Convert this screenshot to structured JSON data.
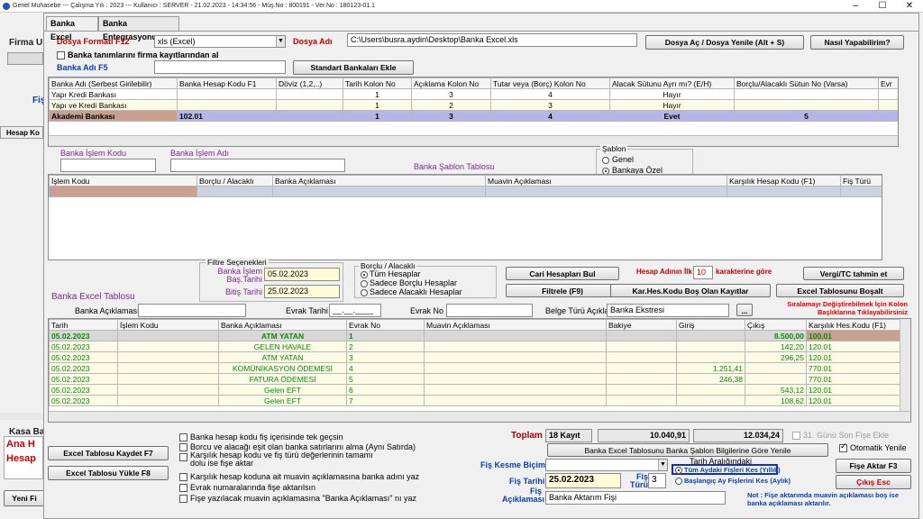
{
  "titlebar": {
    "text": "Genel Muhasebe  ---  Çalışma Yılı : 2023  ---  Kullanıcı : SERVER - 21.02.2023 - 14:34:56 - Müş.No : 800191 - Ver.No : 180123-01.1"
  },
  "background": {
    "firma": "Firma U",
    "fis": "Fiş",
    "hesap_kodu": "Hesap Ko",
    "kasa": "Kasa Ba",
    "ana": "Ana H",
    "hesap": "Hesap",
    "yeni": "Yeni Fi"
  },
  "tabs": [
    "Banka Excel",
    "Banka Entegrasyonu"
  ],
  "top": {
    "format_label": "Dosya Formatı F12",
    "format_value": "xls (Excel)",
    "file_label": "Dosya Adı",
    "file_value": "C:\\Users\\busra.aydin\\Desktop\\Banka Excel.xls",
    "open_btn": "Dosya Aç / Dosya Yenile (Alt + S)",
    "how_btn": "Nasıl Yapabilirim?",
    "bank_check_label": "Banka tanımlarını firma kayıtlarından al",
    "bank_name_label": "Banka Adı F5",
    "std_btn": "Standart Bankaları Ekle"
  },
  "bank_table": {
    "columns": [
      "Banka Adı (Serbest Girilebilir)",
      "Banka Hesap Kodu F1",
      "Döviz (1,2,..)",
      "Tarih Kolon No",
      "Açıklama Kolon No",
      "Tutar veya (Borç) Kolon No",
      "Alacak Sütunu Ayrı mı? (E/H)",
      "Borçlu/Alacaklı Sütun No (Varsa)",
      "Evr"
    ],
    "rows": [
      [
        "Yapı Kredi Bankası",
        "",
        "",
        "1",
        "3",
        "4",
        "Hayır",
        "",
        ""
      ],
      [
        "Yapı ve Kredi Bankası",
        "",
        "",
        "1",
        "2",
        "3",
        "Hayır",
        "",
        ""
      ],
      [
        "Akademi Bankası",
        "102.01",
        "",
        "1",
        "3",
        "4",
        "Evet",
        "5",
        ""
      ]
    ]
  },
  "sablon": {
    "islem_kodu_label": "Banka İşlem Kodu",
    "islem_adi_label": "Banka İşlem Adı",
    "table_title": "Banka Şablon Tablosu",
    "group_title": "Şablon",
    "opt_genel": "Genel",
    "opt_ozel": "Bankaya Özel",
    "columns": [
      "İşlem Kodu",
      "Borçlu / Alacaklı",
      "Banka Açıklaması",
      "Muavin Açıklaması",
      "Karşılık Hesap Kodu (F1)",
      "Fiş Türü"
    ]
  },
  "filter": {
    "group_title": "Filtre Seçenekleri",
    "start_label": "Banka İşlem Baş.Tarihi",
    "start_value": "05.02.2023",
    "end_label": "Bitiş Tarihi",
    "end_value": "25.02.2023",
    "ba_group": "Borçlu / Alacaklı",
    "ba_all": "Tüm Hesaplar",
    "ba_borc": "Sadece Borçlu Hesaplar",
    "ba_alacak": "Sadece Alacaklı Hesaplar",
    "cari_btn": "Cari Hesapları Bul",
    "filtrele_btn": "Filtrele (F9)",
    "hesap_adi_prefix": "Hesap Adının  İlk",
    "hesap_adi_value": "10",
    "hesap_adi_suffix": "karakterine göre",
    "vergi_btn": "Vergi/TC tahmin et",
    "karhes_btn": "Kar.Hes.Kodu Boş Olan Kayıtlar",
    "bosalt_btn": "Excel Tablosunu Boşalt",
    "sort_note": "Sıralamayı Değiştirebilmek İçin Kolon Başlıklarına Tıklayabilirsiniz"
  },
  "excel": {
    "title": "Banka Excel Tablosu",
    "aciklama_label": "Banka Açıklaması",
    "evrak_tarihi_label": "Evrak Tarihi",
    "evrak_tarihi_value": "__.__.____",
    "evrak_no_label": "Evrak No",
    "belge_label": "Belge Türü Açıklaması",
    "belge_value": "Banka Ekstresi",
    "dots": "...",
    "columns": [
      "Tarih",
      "İşlem Kodu",
      "Banka Açıklaması",
      "Evrak No",
      "Muavin Açıklaması",
      "Bakiye",
      "Giriş",
      "Çıkış",
      "Karşılık Hes.Kodu (F1)"
    ],
    "rows": [
      [
        "05.02.2023",
        "",
        "ATM YATAN",
        "1",
        "",
        "",
        "",
        "8.500,00",
        "100.01"
      ],
      [
        "05.02.2023",
        "",
        "GELEN HAVALE",
        "2",
        "",
        "",
        "",
        "142,20",
        "120.01"
      ],
      [
        "05.02.2023",
        "",
        "ATM YATAN",
        "3",
        "",
        "",
        "",
        "296,25",
        "120.01"
      ],
      [
        "05.02.2023",
        "",
        "KOMÜNİKASYON ÖDEMESİ",
        "4",
        "",
        "",
        "1.251,41",
        "",
        "770.01"
      ],
      [
        "05.02.2023",
        "",
        "FATURA ÖDEMESİ",
        "5",
        "",
        "",
        "246,38",
        "",
        "770.01"
      ],
      [
        "05.02.2023",
        "",
        "Gelen EFT",
        "6",
        "",
        "",
        "",
        "543,12",
        "120.01"
      ],
      [
        "05.02.2023",
        "",
        "Gelen EFT",
        "7",
        "",
        "",
        "",
        "108,62",
        "120.01"
      ]
    ]
  },
  "bottom": {
    "save_btn": "Excel Tablosu Kaydet F7",
    "load_btn": "Excel Tablosu Yükle F8",
    "options": [
      "Banka hesap kodu fiş içerisinde tek geçsin",
      "Borcu ve alacağı eşit olan banka satırlarını alma (Aynı Satırda)",
      "Karşılık hesap kodu ve fiş türü değerlerinin tamamı dolu ise fişe aktar",
      "Karşılık hesap koduna ait muavin açıklamasına banka adını yaz",
      "Evrak numaralarında fişe aktarılsın",
      "Fişe yazılacak muavin açıklamasına \"Banka Açıklaması\" nı yaz"
    ],
    "toplam_label": "Toplam",
    "kayit": "18 Kayıt",
    "giris_total": "10.040,91",
    "cikis_total": "12.034,24",
    "son_fise_label": "31. Günü Son Fişe Ekle",
    "update_btn": "Banka Excel Tablosunu Banka Şablon Bilgilerine Göre Yenile",
    "oto_label": "Otomatik Yenile",
    "kesme_label": "Fiş Kesme Biçimi",
    "tarih_group": "Tarih Aralığındaki",
    "opt_tum": "Tüm Aydaki Fişleri Kes (Yıllık)",
    "opt_bas": "Başlangıç Ay Fişlerini Kes (Aylık)",
    "fis_tarihi_label": "Fiş Tarihi",
    "fis_tarihi_value": "25.02.2023",
    "fis_turu_label": "Fiş Türü",
    "fis_turu_value": "3",
    "fis_aciklama_label": "Fiş Açıklaması",
    "fis_aciklama_value": "Banka Aktarım Fişi",
    "aktar_btn": "Fişe Aktar F3",
    "cikis_btn": "Çıkış Esc",
    "note": "Not : Fişe aktarımda muavin açıklaması boş ise banka açıklaması aktarılır."
  }
}
